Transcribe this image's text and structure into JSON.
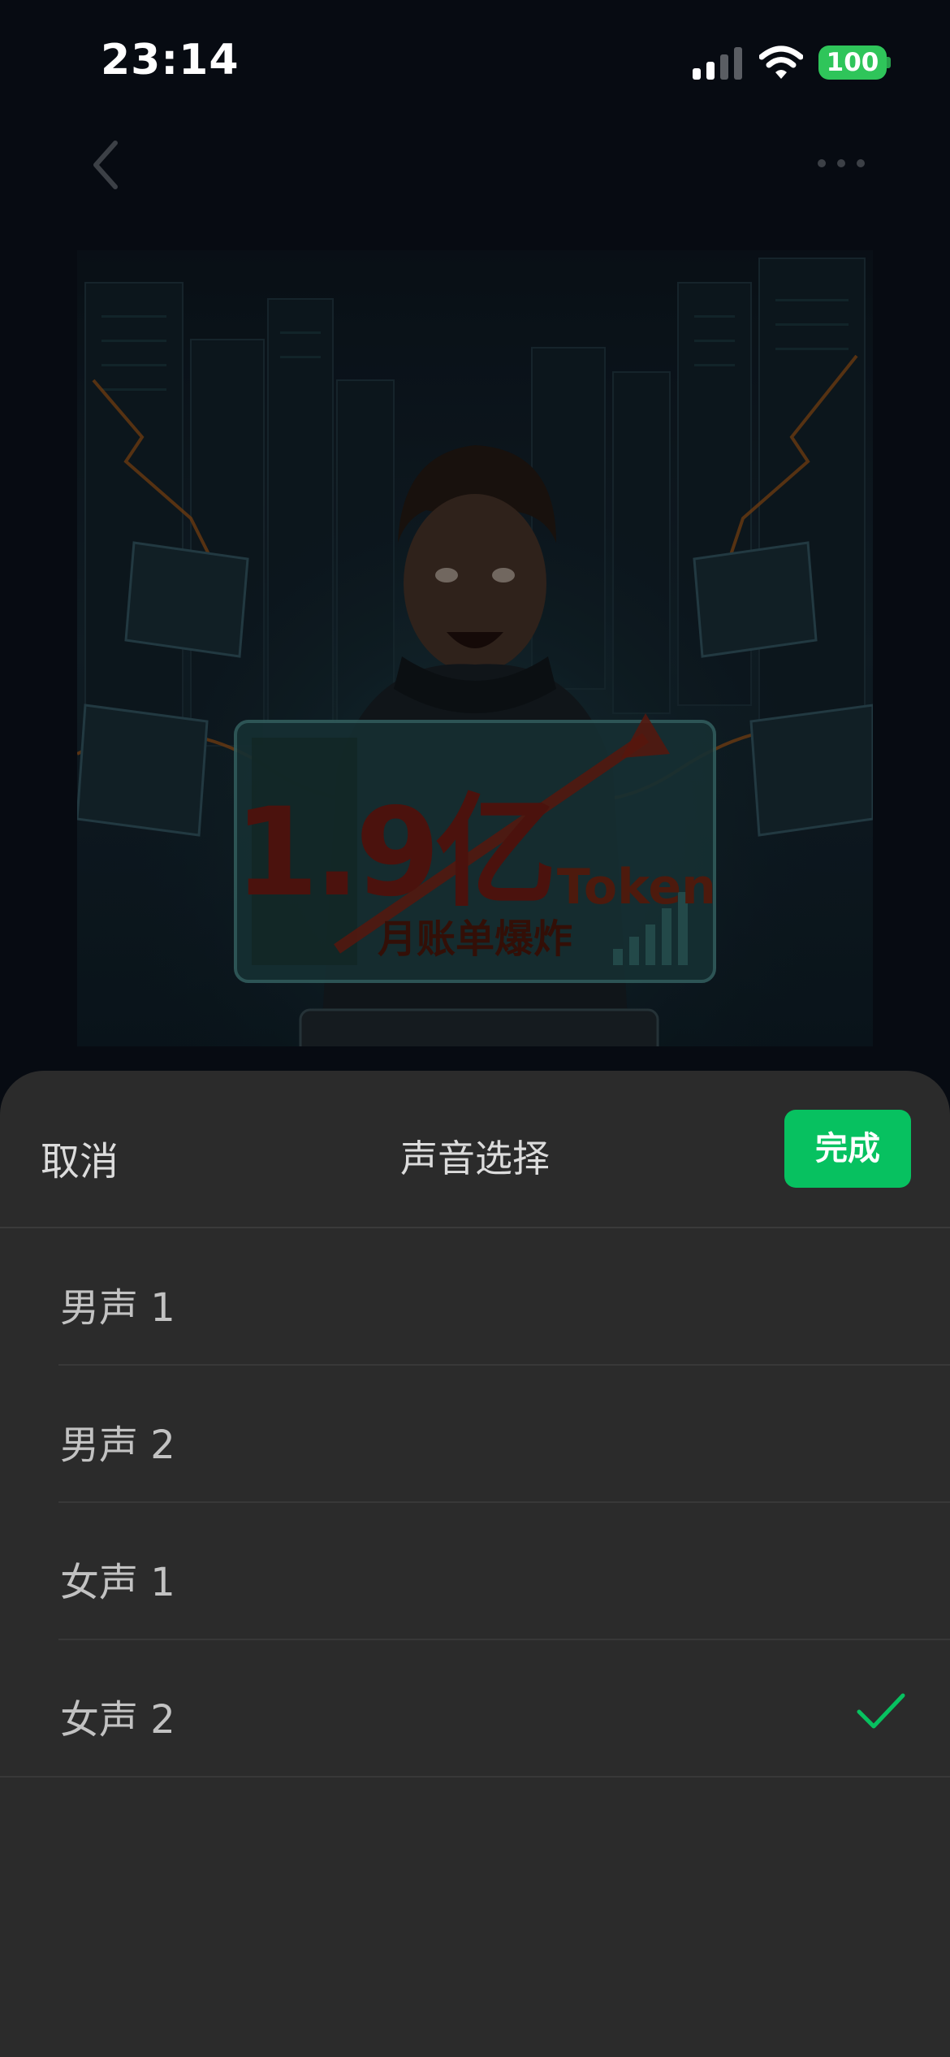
{
  "status_bar": {
    "time": "23:14",
    "battery": "100",
    "icons": [
      "signal-icon",
      "wifi-icon",
      "battery-icon"
    ]
  },
  "nav": {
    "back_icon": "chevron-left-icon",
    "more_icon": "more-horizontal-icon"
  },
  "cover": {
    "headline": "1.9亿",
    "headline_suffix": "Token",
    "subtitle": "月账单爆炸"
  },
  "sheet": {
    "cancel_label": "取消",
    "title": "声音选择",
    "done_label": "完成",
    "options": [
      {
        "label": "男声 1",
        "selected": false
      },
      {
        "label": "男声 2",
        "selected": false
      },
      {
        "label": "女声 1",
        "selected": false
      },
      {
        "label": "女声 2",
        "selected": true
      }
    ],
    "check_icon": "checkmark-icon"
  },
  "colors": {
    "accent": "#07c160",
    "sheet_background": "#2b2b2b",
    "battery": "#2fc55a"
  }
}
